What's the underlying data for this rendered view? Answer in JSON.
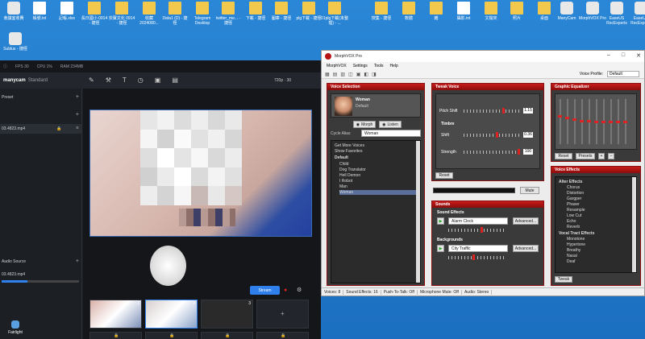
{
  "desktop": {
    "icons": [
      {
        "label": "會議室收費",
        "type": "app"
      },
      {
        "label": "帳號.txt",
        "type": "doc"
      },
      {
        "label": "記帳.xlsx",
        "type": "doc"
      },
      {
        "label": "長日國小 0914 - 捷徑",
        "type": "folder"
      },
      {
        "label": "崇寶文化 0914 - 捷徑",
        "type": "folder"
      },
      {
        "label": "收藏 2024080...",
        "type": "folder"
      },
      {
        "label": "Data1 (D) - 捷徑",
        "type": "folder"
      },
      {
        "label": "Telegram Desktop",
        "type": "folder"
      },
      {
        "label": "twitter_me... - 捷徑",
        "type": "folder"
      },
      {
        "label": "下載 - 捷徑",
        "type": "folder"
      },
      {
        "label": "圖庫 - 捷徑",
        "type": "folder"
      },
      {
        "label": "plg下載 - 捷徑",
        "type": "folder"
      },
      {
        "label": "01plg下載(未整理) - ...",
        "type": "folder"
      },
      {
        "label": "搜集 - 捷徑",
        "type": "folder"
      },
      {
        "label": "軟體",
        "type": "folder"
      },
      {
        "label": "雜",
        "type": "folder"
      },
      {
        "label": "攝影.txt",
        "type": "doc"
      },
      {
        "label": "文檔夾",
        "type": "folder"
      },
      {
        "label": "照片",
        "type": "folder"
      },
      {
        "label": "桌面",
        "type": "folder"
      },
      {
        "label": "ManyCam",
        "type": "app"
      },
      {
        "label": "MorphVOX Pro",
        "type": "app"
      },
      {
        "label": "EaseUS RecExperts",
        "type": "app"
      },
      {
        "label": "EaseUS RecExperts",
        "type": "app"
      }
    ],
    "left_icon": "Sublus - 捷徑",
    "bottom_icon": "Fairlight"
  },
  "manycam": {
    "fps": "FPS 30",
    "cpu": "CPU 1%",
    "ram": "RAM 234MB",
    "logo": "manycam",
    "edition": "Standard",
    "preset": "Preset",
    "source_file": "03.4823.mp4",
    "audio_source": "Audio Source",
    "audio_file": "03.4823.mp4",
    "resolution": "720p · 30",
    "stream": "Stream",
    "thumb_numbers": [
      "1",
      "2",
      "3"
    ]
  },
  "morphvox": {
    "title": "MorphVOX Pro",
    "menu": [
      "MorphVOX",
      "Settings",
      "Tools",
      "Help"
    ],
    "voice_profile_label": "Voice Profile:",
    "voice_profile": "Default",
    "voice_selection": "Voice Selection",
    "voice_name": "Woman",
    "voice_subtitle": "Default",
    "morph": "Morph",
    "listen": "Listen",
    "cycle_alias": "Cycle Alias",
    "alias_value": "Woman",
    "voice_list": [
      "Get More Voices",
      "Show Favorites",
      "Default",
      "Child",
      "Dog Translator",
      "Hell Demon",
      "I Robot",
      "Man",
      "Woman"
    ],
    "tweak_voice": "Tweak Voice",
    "pitch_shift": "Pitch Shift",
    "pitch_value": "1.15",
    "timbre": "Timbre",
    "shift": "Shift",
    "shift_value": "0.36",
    "strength": "Strength",
    "strength_value": "100",
    "reset": "Reset",
    "mute": "Mute",
    "sounds": "Sounds",
    "sound_effects": "Sound Effects",
    "sound_effect_value": "Alarm Clock",
    "advanced": "Advanced...",
    "backgrounds": "Backgrounds",
    "background_value": "City Traffic",
    "graphic_eq": "Graphic Equalizer",
    "eq_reset": "Reset",
    "eq_presets": "Presets",
    "voice_effects": "Voice Effects",
    "effects": [
      "Alter Effects",
      "Chorus",
      "Distortion",
      "Gargper",
      "Phaser",
      "Resample",
      "Low Cut",
      "Echo",
      "Reverb",
      "Vocal Tract Effects",
      "Monotone",
      "Hypertone",
      "Breathy",
      "Nasal",
      "Deaf"
    ],
    "tweak": "Tweak",
    "status": [
      "Voices: 8",
      "Sound Effects: 16",
      "Push-To-Talk: Off",
      "Microphone Mute: Off",
      "Audio: Stereo"
    ],
    "accent": "#b81414"
  }
}
